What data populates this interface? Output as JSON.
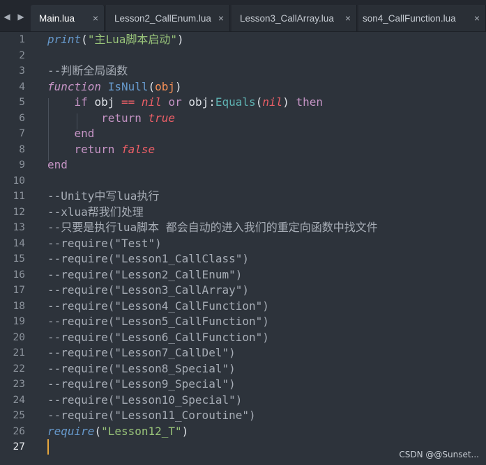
{
  "tabs": [
    {
      "label": "Main.lua",
      "close": "×"
    },
    {
      "label": "Lesson2_CallEnum.lua",
      "close": "×"
    },
    {
      "label": "Lesson3_CallArray.lua",
      "close": "×"
    },
    {
      "label": "son4_CallFunction.lua",
      "close": "×"
    }
  ],
  "nav": {
    "back": "◀",
    "forward": "▶"
  },
  "line_numbers": [
    "1",
    "2",
    "3",
    "4",
    "5",
    "6",
    "7",
    "8",
    "9",
    "10",
    "11",
    "12",
    "13",
    "14",
    "15",
    "16",
    "17",
    "18",
    "19",
    "20",
    "21",
    "22",
    "23",
    "24",
    "25",
    "26",
    "27"
  ],
  "code": {
    "l1": {
      "fn": "print",
      "p1": "(",
      "s": "\"主Lua脚本启动\"",
      "p2": ")"
    },
    "l3": "--判断全局函数",
    "l4": {
      "kw": "function",
      "name": "IsNull",
      "p1": "(",
      "param": "obj",
      "p2": ")"
    },
    "l5": {
      "kw_if": "if",
      "var1": "obj",
      "op": "==",
      "nil1": "nil",
      "kw_or": "or",
      "var2": "obj",
      "colon": ":",
      "meth": "Equals",
      "p1": "(",
      "nil2": "nil",
      "p2": ")",
      "kw_then": "then"
    },
    "l6": {
      "kw": "return",
      "val": "true"
    },
    "l7": "end",
    "l8": {
      "kw": "return",
      "val": "false"
    },
    "l9": "end",
    "l11": "--Unity中写lua执行",
    "l12": "--xlua帮我们处理",
    "l13": "--只要是执行lua脚本 都会自动的进入我们的重定向函数中找文件",
    "l14": "--require(\"Test\")",
    "l15": "--require(\"Lesson1_CallClass\")",
    "l16": "--require(\"Lesson2_CallEnum\")",
    "l17": "--require(\"Lesson3_CallArray\")",
    "l18": "--require(\"Lesson4_CallFunction\")",
    "l19": "--require(\"Lesson5_CallFunction\")",
    "l20": "--require(\"Lesson6_CallFunction\")",
    "l21": "--require(\"Lesson7_CallDel\")",
    "l22": "--require(\"Lesson8_Special\")",
    "l23": "--require(\"Lesson9_Special\")",
    "l24": "--require(\"Lesson10_Special\")",
    "l25": "--require(\"Lesson11_Coroutine\")",
    "l26": {
      "fn": "require",
      "p1": "(",
      "s": "\"Lesson12_T\"",
      "p2": ")"
    }
  },
  "watermark": "CSDN @@Sunset...",
  "colors": {
    "background": "#2d333b",
    "caret": "#e8a83d",
    "keyword": "#c594c5",
    "function": "#6699cc",
    "string": "#98c379",
    "constant": "#ec5f67"
  }
}
